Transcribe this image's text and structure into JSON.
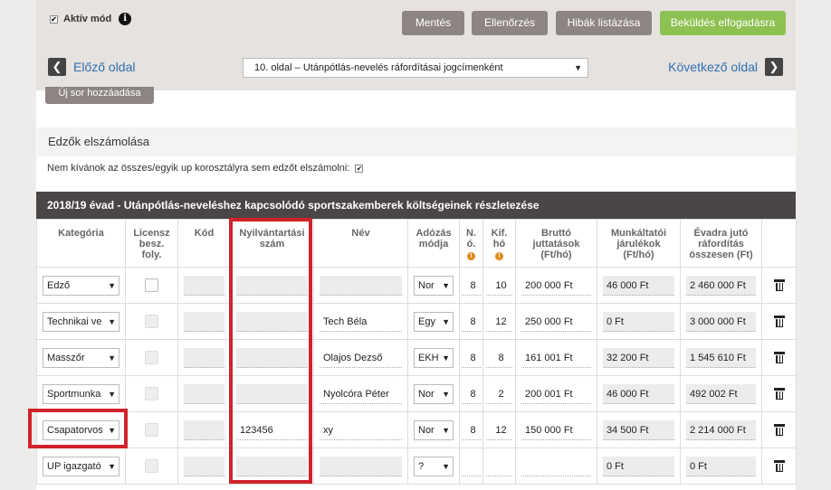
{
  "toolbar": {
    "active_mode": "Aktív mód",
    "check_mark": "✔",
    "info": "i",
    "save": "Mentés",
    "check": "Ellenőrzés",
    "list_errors": "Hibák listázása",
    "submit": "Beküldés elfogadásra"
  },
  "nav": {
    "prev": "Előző oldal",
    "next": "Következő oldal",
    "page": "10. oldal – Utánpótlás-nevelés ráfordításai jogcímenként",
    "prev_arrow": "❮",
    "next_arrow": "❯",
    "dropdown_arrow": "▼"
  },
  "add_row": "Új sor hozzáadása",
  "coaches": {
    "title": "Edzők elszámolása",
    "no_coach_label": "Nem kívánok az összes/egyik up korosztályra sem edzőt elszámolni:"
  },
  "season_title": "2018/19 évad - Utánpótlás-neveléshez kapcsolódó sportszakemberek költségeinek részletezése",
  "columns": {
    "category": "Kategória",
    "license_1": "Licensz",
    "license_2": "besz.",
    "license_3": "foly.",
    "code": "Kód",
    "registry_1": "Nyilvántartási",
    "registry_2": "szám",
    "name": "Név",
    "tax_1": "Adózás",
    "tax_2": "módja",
    "n_1": "N.",
    "n_2": "ó.",
    "kif_1": "Kif.",
    "kif_2": "hó",
    "gross_1": "Bruttó",
    "gross_2": "juttatások",
    "gross_3": "(Ft/hó)",
    "employer_1": "Munkáltatói",
    "employer_2": "járulékok",
    "employer_3": "(Ft/hó)",
    "season_1": "Évadra jutó",
    "season_2": "ráfordítás",
    "season_3": "összesen (Ft)",
    "coin": "!"
  },
  "rows": [
    {
      "category": "Edző",
      "name": "",
      "tax": "Nor",
      "n": "8",
      "kif": "10",
      "gross": "200 000 Ft",
      "employer": "46 000 Ft",
      "total": "2 460 000 Ft",
      "registry": "",
      "checkbox_on": true
    },
    {
      "category": "Technikai ve",
      "name": "Tech Béla",
      "tax": "Egy",
      "n": "8",
      "kif": "12",
      "gross": "250 000 Ft",
      "employer": "0 Ft",
      "total": "3 000 000 Ft",
      "registry": "",
      "checkbox_on": false
    },
    {
      "category": "Masszőr",
      "name": "Olajos Dezső",
      "tax": "EKH",
      "n": "8",
      "kif": "8",
      "gross": "161 001 Ft",
      "employer": "32 200 Ft",
      "total": "1 545 610 Ft",
      "registry": "",
      "checkbox_on": false
    },
    {
      "category": "Sportmunka",
      "name": "Nyolcóra Péter",
      "tax": "Nor",
      "n": "8",
      "kif": "2",
      "gross": "200 001 Ft",
      "employer": "46 000 Ft",
      "total": "492 002 Ft",
      "registry": "",
      "checkbox_on": false
    },
    {
      "category": "Csapatorvos",
      "name": "xy",
      "tax": "Nor",
      "n": "8",
      "kif": "12",
      "gross": "150 000 Ft",
      "employer": "34 500 Ft",
      "total": "2 214 000 Ft",
      "registry": "123456",
      "checkbox_on": false
    },
    {
      "category": "UP igazgató",
      "name": "",
      "tax": "?",
      "n": "",
      "kif": "",
      "gross": "",
      "employer": "0 Ft",
      "total": "0 Ft",
      "registry": "",
      "checkbox_on": false
    }
  ],
  "colors": {
    "accent_green": "#8dc152",
    "button_gray": "#8c8583",
    "header_dark": "#4a4645",
    "highlight_red": "#d0232b",
    "link_blue": "#2f6fb0"
  }
}
